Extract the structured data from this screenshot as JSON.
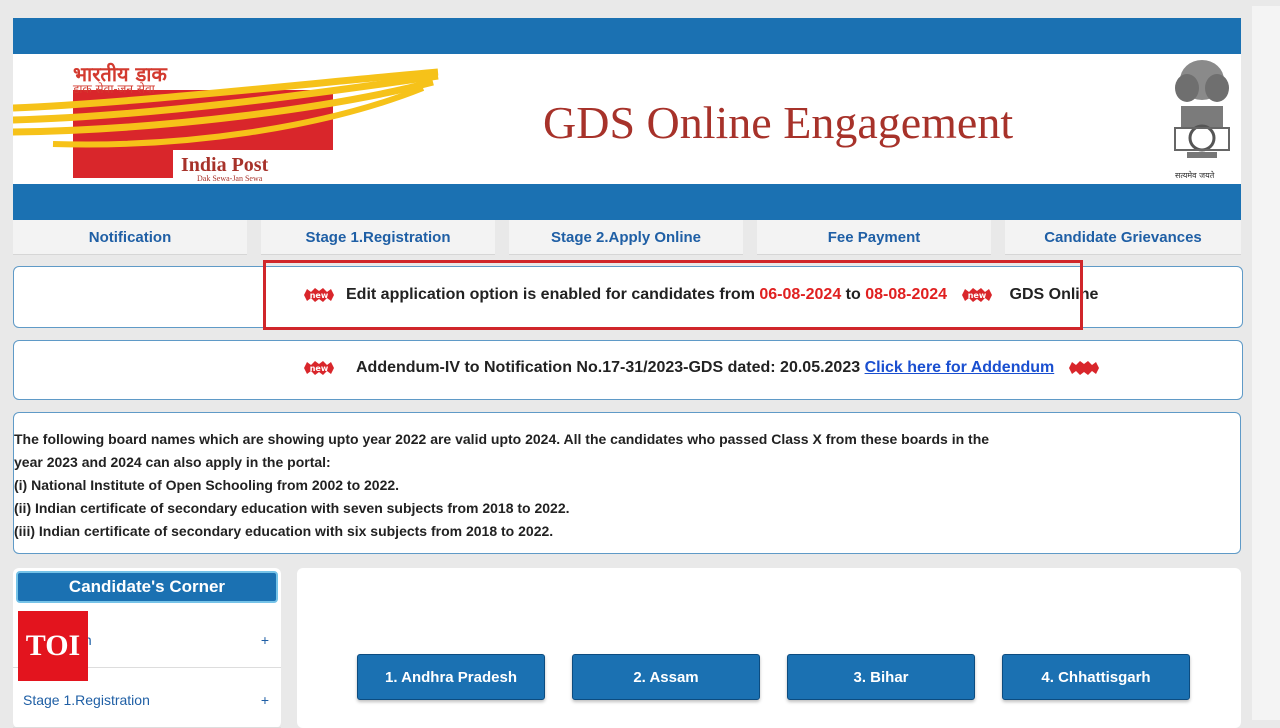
{
  "header": {
    "logo_hindi_line1": "भारतीय डाक",
    "logo_hindi_line2": "डाक सेवा-जन सेवा",
    "logo_name": "India Post",
    "logo_tagline": "Dak Sewa-Jan Sewa",
    "title": "GDS Online Engagement",
    "emblem_text": "सत्यमेव जयते"
  },
  "nav": {
    "items": [
      {
        "label": "Notification"
      },
      {
        "label": "Stage 1.Registration"
      },
      {
        "label": "Stage 2.Apply Online"
      },
      {
        "label": "Fee Payment"
      },
      {
        "label": "Candidate Grievances"
      }
    ]
  },
  "marquee1": {
    "text_before": "Edit application option is enabled for candidates from ",
    "date_from": "06-08-2024",
    "text_mid": " to ",
    "date_to": "08-08-2024",
    "trailing": "GDS Online"
  },
  "marquee2": {
    "text": "Addendum-IV to Notification No.17-31/2023-GDS dated: 20.05.2023 ",
    "link": "Click here for Addendum"
  },
  "info": {
    "lines": [
      "The following board names which are showing upto year 2022 are valid upto 2024. All the candidates who passed Class X from these boards in the",
      "year 2023 and 2024 can also apply in the portal:",
      "(i) National Institute of Open Schooling from 2002 to 2022.",
      "(ii) Indian certificate of secondary education with seven subjects from 2018 to 2022.",
      "(iii) Indian certificate of secondary education with six subjects from 2018 to 2022."
    ]
  },
  "sidebar": {
    "heading": "Candidate's Corner",
    "items": [
      {
        "label": "ion",
        "toggle": "+"
      },
      {
        "label": "Stage 1.Registration",
        "toggle": "+"
      }
    ]
  },
  "watermark": "TOI",
  "states": [
    {
      "label": "1. Andhra Pradesh"
    },
    {
      "label": "2. Assam"
    },
    {
      "label": "3. Bihar"
    },
    {
      "label": "4. Chhattisgarh"
    }
  ],
  "colors": {
    "primary_blue": "#1b71b2",
    "title_red": "#a7322a",
    "date_red": "#e02020",
    "highlight_red": "#d0262a",
    "link_blue": "#1a4fd0"
  }
}
